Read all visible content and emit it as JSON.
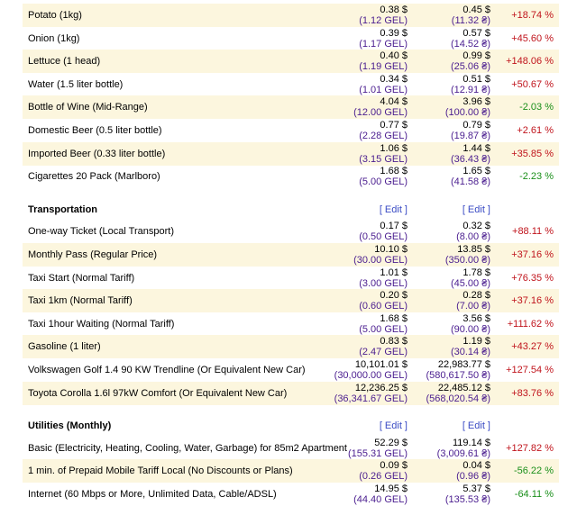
{
  "groceries": [
    {
      "item": "Potato (1kg)",
      "usd1": "0.38 $",
      "loc1": "(1.12 GEL)",
      "usd2": "0.45 $",
      "loc2": "(11.32 ₴)",
      "change": "+18.74 %"
    },
    {
      "item": "Onion (1kg)",
      "usd1": "0.39 $",
      "loc1": "(1.17 GEL)",
      "usd2": "0.57 $",
      "loc2": "(14.52 ₴)",
      "change": "+45.60 %"
    },
    {
      "item": "Lettuce (1 head)",
      "usd1": "0.40 $",
      "loc1": "(1.19 GEL)",
      "usd2": "0.99 $",
      "loc2": "(25.06 ₴)",
      "change": "+148.06 %"
    },
    {
      "item": "Water (1.5 liter bottle)",
      "usd1": "0.34 $",
      "loc1": "(1.01 GEL)",
      "usd2": "0.51 $",
      "loc2": "(12.91 ₴)",
      "change": "+50.67 %"
    },
    {
      "item": "Bottle of Wine (Mid-Range)",
      "usd1": "4.04 $",
      "loc1": "(12.00 GEL)",
      "usd2": "3.96 $",
      "loc2": "(100.00 ₴)",
      "change": "-2.03 %"
    },
    {
      "item": "Domestic Beer (0.5 liter bottle)",
      "usd1": "0.77 $",
      "loc1": "(2.28 GEL)",
      "usd2": "0.79 $",
      "loc2": "(19.87 ₴)",
      "change": "+2.61 %"
    },
    {
      "item": "Imported Beer (0.33 liter bottle)",
      "usd1": "1.06 $",
      "loc1": "(3.15 GEL)",
      "usd2": "1.44 $",
      "loc2": "(36.43 ₴)",
      "change": "+35.85 %"
    },
    {
      "item": "Cigarettes 20 Pack (Marlboro)",
      "usd1": "1.68 $",
      "loc1": "(5.00 GEL)",
      "usd2": "1.65 $",
      "loc2": "(41.58 ₴)",
      "change": "-2.23 %"
    }
  ],
  "transportation": {
    "title": "Transportation",
    "edit1": "[ Edit ]",
    "edit2": "[ Edit ]",
    "rows": [
      {
        "item": "One-way Ticket (Local Transport)",
        "usd1": "0.17 $",
        "loc1": "(0.50 GEL)",
        "usd2": "0.32 $",
        "loc2": "(8.00 ₴)",
        "change": "+88.11 %"
      },
      {
        "item": "Monthly Pass (Regular Price)",
        "usd1": "10.10 $",
        "loc1": "(30.00 GEL)",
        "usd2": "13.85 $",
        "loc2": "(350.00 ₴)",
        "change": "+37.16 %"
      },
      {
        "item": "Taxi Start (Normal Tariff)",
        "usd1": "1.01 $",
        "loc1": "(3.00 GEL)",
        "usd2": "1.78 $",
        "loc2": "(45.00 ₴)",
        "change": "+76.35 %"
      },
      {
        "item": "Taxi 1km (Normal Tariff)",
        "usd1": "0.20 $",
        "loc1": "(0.60 GEL)",
        "usd2": "0.28 $",
        "loc2": "(7.00 ₴)",
        "change": "+37.16 %"
      },
      {
        "item": "Taxi 1hour Waiting (Normal Tariff)",
        "usd1": "1.68 $",
        "loc1": "(5.00 GEL)",
        "usd2": "3.56 $",
        "loc2": "(90.00 ₴)",
        "change": "+111.62 %"
      },
      {
        "item": "Gasoline (1 liter)",
        "usd1": "0.83 $",
        "loc1": "(2.47 GEL)",
        "usd2": "1.19 $",
        "loc2": "(30.14 ₴)",
        "change": "+43.27 %"
      },
      {
        "item": "Volkswagen Golf 1.4 90 KW Trendline (Or Equivalent New Car)",
        "usd1": "10,101.01 $",
        "loc1": "(30,000.00 GEL)",
        "usd2": "22,983.77 $",
        "loc2": "(580,617.50 ₴)",
        "change": "+127.54 %"
      },
      {
        "item": "Toyota Corolla 1.6l 97kW Comfort (Or Equivalent New Car)",
        "usd1": "12,236.25 $",
        "loc1": "(36,341.67 GEL)",
        "usd2": "22,485.12 $",
        "loc2": "(568,020.54 ₴)",
        "change": "+83.76 %"
      }
    ]
  },
  "utilities": {
    "title": "Utilities (Monthly)",
    "edit1": "[ Edit ]",
    "edit2": "[ Edit ]",
    "rows": [
      {
        "item": "Basic (Electricity, Heating, Cooling, Water, Garbage) for 85m2 Apartment",
        "usd1": "52.29 $",
        "loc1": "(155.31 GEL)",
        "usd2": "119.14 $",
        "loc2": "(3,009.61 ₴)",
        "change": "+127.82 %"
      },
      {
        "item": "1 min. of Prepaid Mobile Tariff Local (No Discounts or Plans)",
        "usd1": "0.09 $",
        "loc1": "(0.26 GEL)",
        "usd2": "0.04 $",
        "loc2": "(0.96 ₴)",
        "change": "-56.22 %"
      },
      {
        "item": "Internet (60 Mbps or More, Unlimited Data, Cable/ADSL)",
        "usd1": "14.95 $",
        "loc1": "(44.40 GEL)",
        "usd2": "5.37 $",
        "loc2": "(135.53 ₴)",
        "change": "-64.11 %"
      }
    ]
  },
  "colors": {
    "row_alt": "#fcf6de",
    "positive": "#c0141c",
    "negative": "#1a8f1a",
    "local": "#4a1d8f",
    "link": "#3a4bc4"
  }
}
